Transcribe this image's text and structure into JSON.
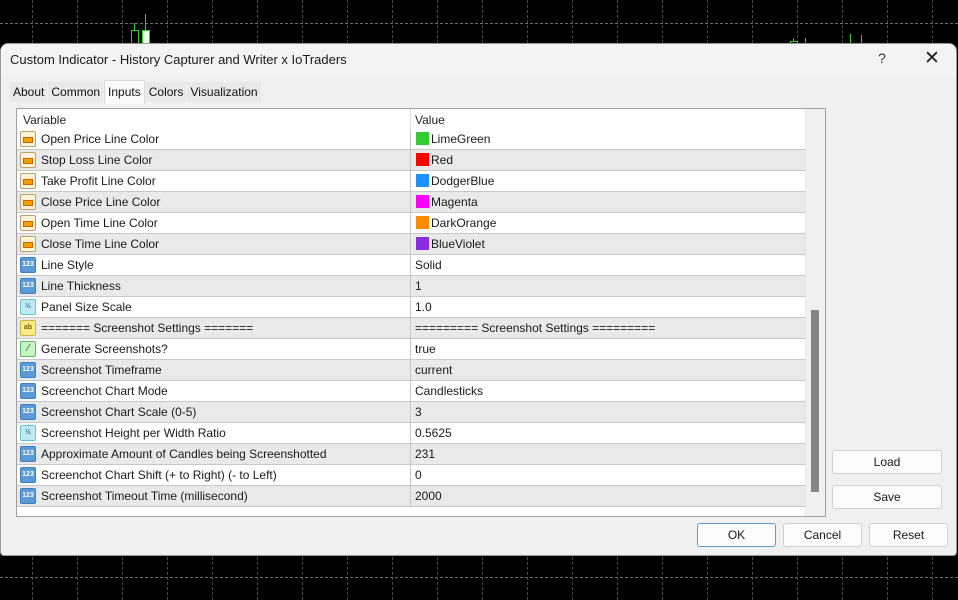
{
  "window": {
    "title": "Custom Indicator - History Capturer and Writer x IoTraders",
    "help_label": "?",
    "close_label": "✕"
  },
  "tabs": [
    {
      "label": "About",
      "active": false
    },
    {
      "label": "Common",
      "active": false
    },
    {
      "label": "Inputs",
      "active": true
    },
    {
      "label": "Colors",
      "active": false
    },
    {
      "label": "Visualization",
      "active": false
    }
  ],
  "table": {
    "headers": {
      "variable": "Variable",
      "value": "Value"
    },
    "rows": [
      {
        "icon": "color-icon",
        "type": "color",
        "variable": "Open Price Line Color",
        "value": "LimeGreen",
        "swatch": "#32cd32"
      },
      {
        "icon": "color-icon",
        "type": "color",
        "variable": "Stop Loss Line Color",
        "value": "Red",
        "swatch": "#ff0000"
      },
      {
        "icon": "color-icon",
        "type": "color",
        "variable": "Take Profit Line Color",
        "value": "DodgerBlue",
        "swatch": "#1e90ff"
      },
      {
        "icon": "color-icon",
        "type": "color",
        "variable": "Close Price Line Color",
        "value": "Magenta",
        "swatch": "#ff00ff"
      },
      {
        "icon": "color-icon",
        "type": "color",
        "variable": "Open Time Line Color",
        "value": "DarkOrange",
        "swatch": "#ff8c00"
      },
      {
        "icon": "color-icon",
        "type": "color",
        "variable": "Close Time Line Color",
        "value": "BlueViolet",
        "swatch": "#8a2be2"
      },
      {
        "icon": "integer-icon",
        "type": "int",
        "glyph": "123",
        "variable": "Line Style",
        "value": "Solid"
      },
      {
        "icon": "integer-icon",
        "type": "int",
        "glyph": "123",
        "variable": "Line Thickness",
        "value": "1"
      },
      {
        "icon": "double-icon",
        "type": "dbl",
        "glyph": "½",
        "variable": "Panel Size Scale",
        "value": "1.0"
      },
      {
        "icon": "string-icon",
        "type": "str",
        "glyph": "ab",
        "variable": "======= Screenshot Settings =======",
        "value": "========= Screenshot Settings ========="
      },
      {
        "icon": "bool-icon",
        "type": "bool",
        "glyph": "⁄",
        "variable": "Generate Screenshots?",
        "value": "true"
      },
      {
        "icon": "integer-icon",
        "type": "int",
        "glyph": "123",
        "variable": "Screenshot Timeframe",
        "value": "current"
      },
      {
        "icon": "integer-icon",
        "type": "int",
        "glyph": "123",
        "variable": "Screenchot Chart Mode",
        "value": "Candlesticks"
      },
      {
        "icon": "integer-icon",
        "type": "int",
        "glyph": "123",
        "variable": "Screenshot Chart Scale (0-5)",
        "value": "3"
      },
      {
        "icon": "double-icon",
        "type": "dbl",
        "glyph": "½",
        "variable": "Screenshot Height per Width Ratio",
        "value": "0.5625"
      },
      {
        "icon": "integer-icon",
        "type": "int",
        "glyph": "123",
        "variable": "Approximate Amount of Candles being Screenshotted",
        "value": "231"
      },
      {
        "icon": "integer-icon",
        "type": "int",
        "glyph": "123",
        "variable": "Screenchot Chart Shift (+ to Right) (- to Left)",
        "value": "0"
      },
      {
        "icon": "integer-icon",
        "type": "int",
        "glyph": "123",
        "variable": "Screenshot Timeout Time (millisecond)",
        "value": "2000"
      }
    ]
  },
  "side_buttons": {
    "load": "Load",
    "save": "Save"
  },
  "footer_buttons": {
    "ok": "OK",
    "cancel": "Cancel",
    "reset": "Reset"
  }
}
